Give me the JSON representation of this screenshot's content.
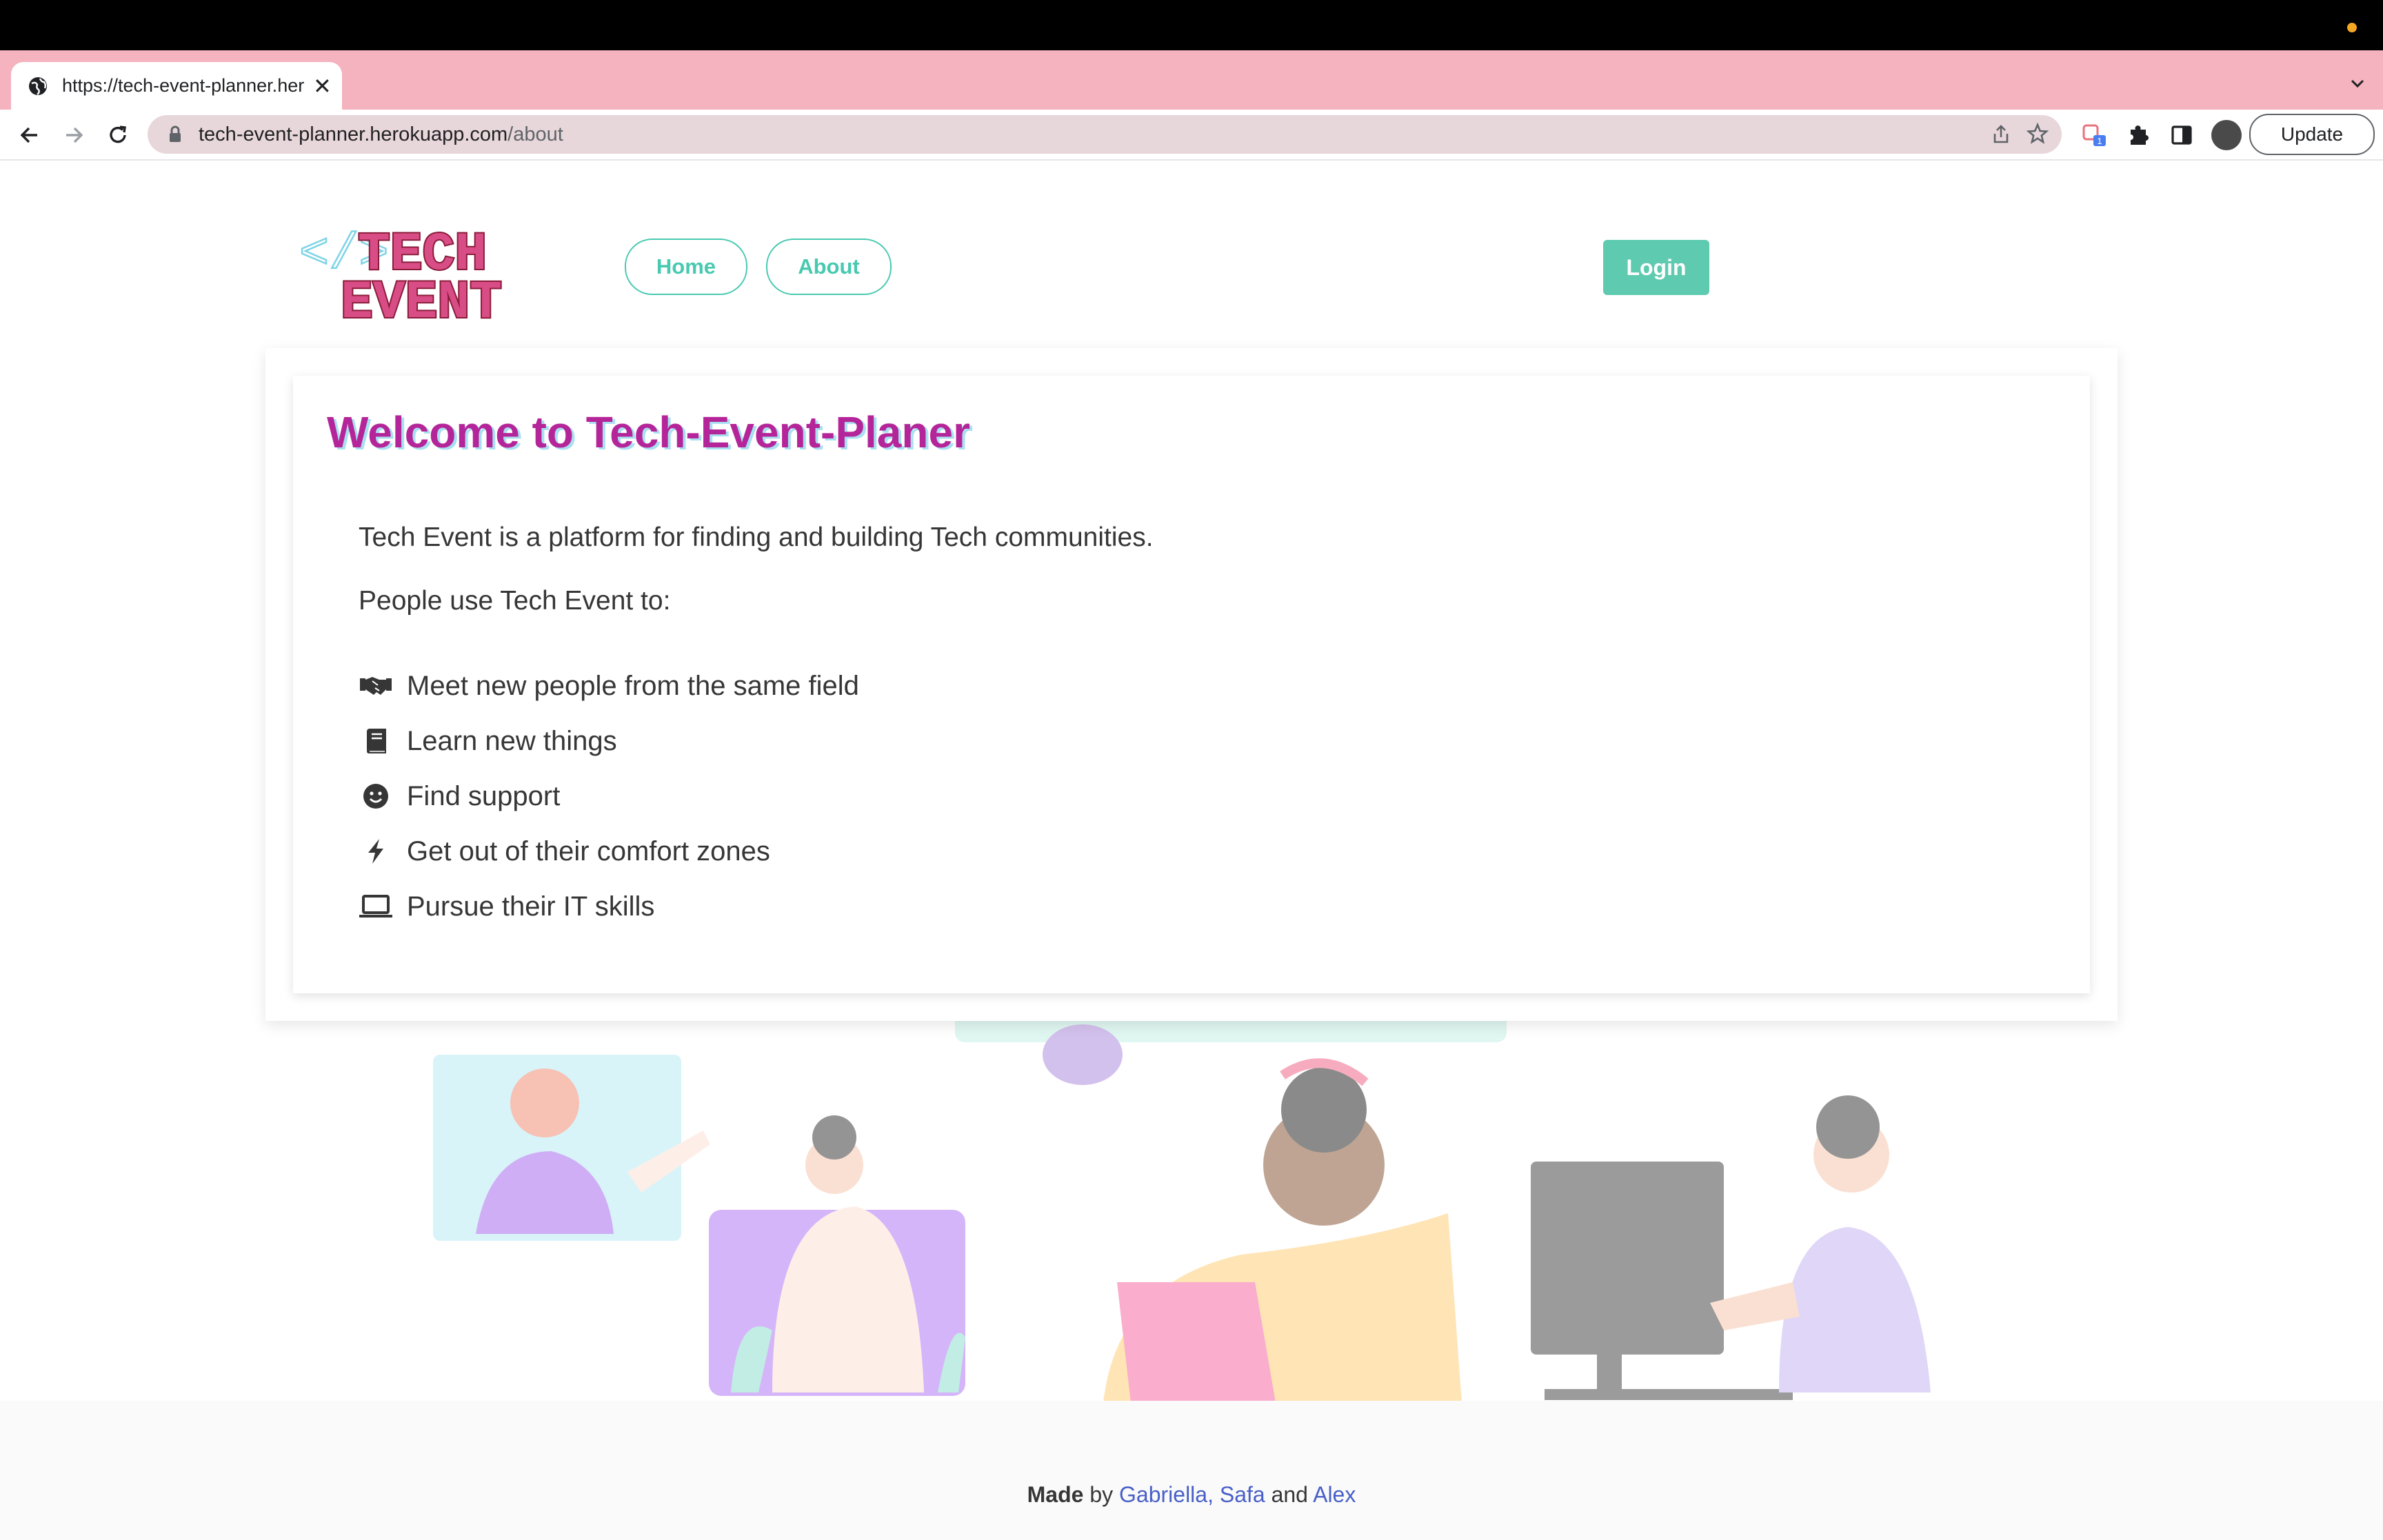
{
  "browser": {
    "tab_title": "https://tech-event-planner.herokuapp.com/about",
    "url_host": "tech-event-planner.herokuapp.com",
    "url_path": "/about",
    "update_label": "Update",
    "extension_badge": "1",
    "new_tab_label": "+",
    "close_label": "✕"
  },
  "header": {
    "logo_line1": "TECH",
    "logo_line2": "EVENT",
    "logo_brackets": "</>",
    "nav": [
      {
        "label": "Home"
      },
      {
        "label": "About"
      }
    ],
    "login_label": "Login"
  },
  "about": {
    "title": "Welcome to Tech-Event-Planer",
    "intro": "Tech Event is a platform for finding and building Tech communities.",
    "uses_intro": "People use Tech Event to:",
    "uses": [
      {
        "icon": "handshake-icon",
        "label": "Meet new people from the same field"
      },
      {
        "icon": "book-icon",
        "label": "Learn new things"
      },
      {
        "icon": "smile-icon",
        "label": "Find support"
      },
      {
        "icon": "bolt-icon",
        "label": "Get out of their comfort zones"
      },
      {
        "icon": "laptop-icon",
        "label": "Pursue their IT skills"
      }
    ]
  },
  "footer": {
    "made": "Made",
    "by": "by",
    "author1": "Gabriella,",
    "author2": "Safa",
    "and": "and",
    "author3": "Alex"
  },
  "colors": {
    "accent": "#48c9b0",
    "title": "#b5259a",
    "tab_strip": "#f4b3be",
    "link": "#485fc7"
  }
}
